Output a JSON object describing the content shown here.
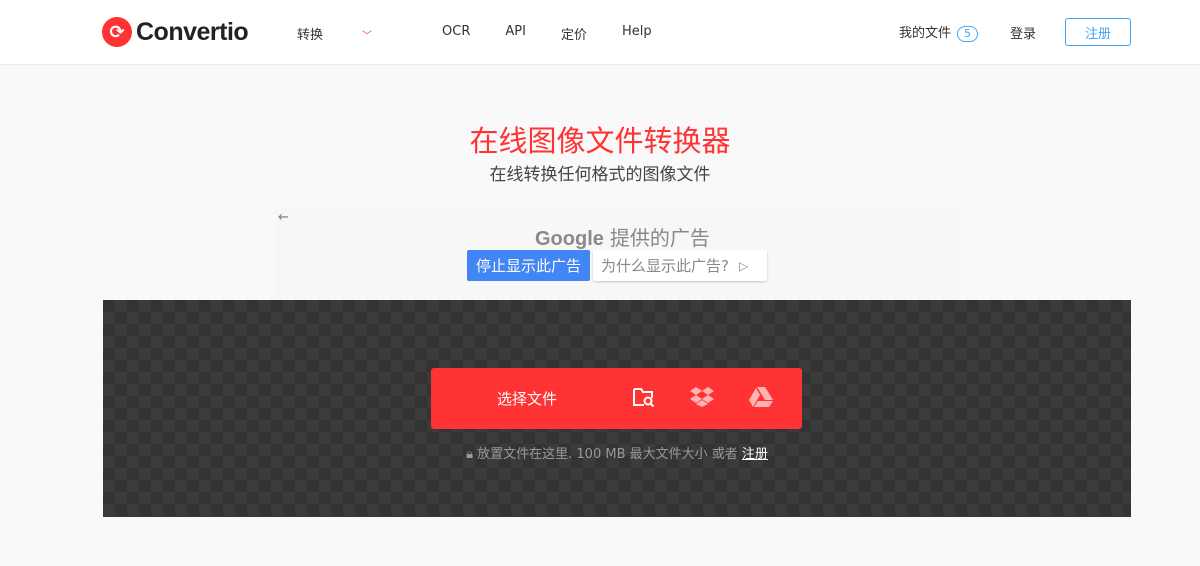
{
  "header": {
    "brand": "Convertio",
    "nav": [
      "转换",
      "OCR",
      "API",
      "定价",
      "Help"
    ],
    "my_files": "我的文件",
    "file_count": "5",
    "login": "登录",
    "signup": "注册"
  },
  "hero": {
    "title": "在线图像文件转换器",
    "subtitle": "在线转换任何格式的图像文件"
  },
  "ad": {
    "back": "←",
    "google": "Google",
    "provided": "提供的广告",
    "stop": "停止显示此广告",
    "why": "为什么显示此广告?"
  },
  "upload": {
    "choose": "选择文件",
    "hint": "放置文件在这里. 100 MB 最大文件大小 或者",
    "hint_link": "注册"
  },
  "colors": {
    "accent": "#ff3333",
    "blue": "#42a5f5",
    "ad_blue": "#4285f4"
  }
}
